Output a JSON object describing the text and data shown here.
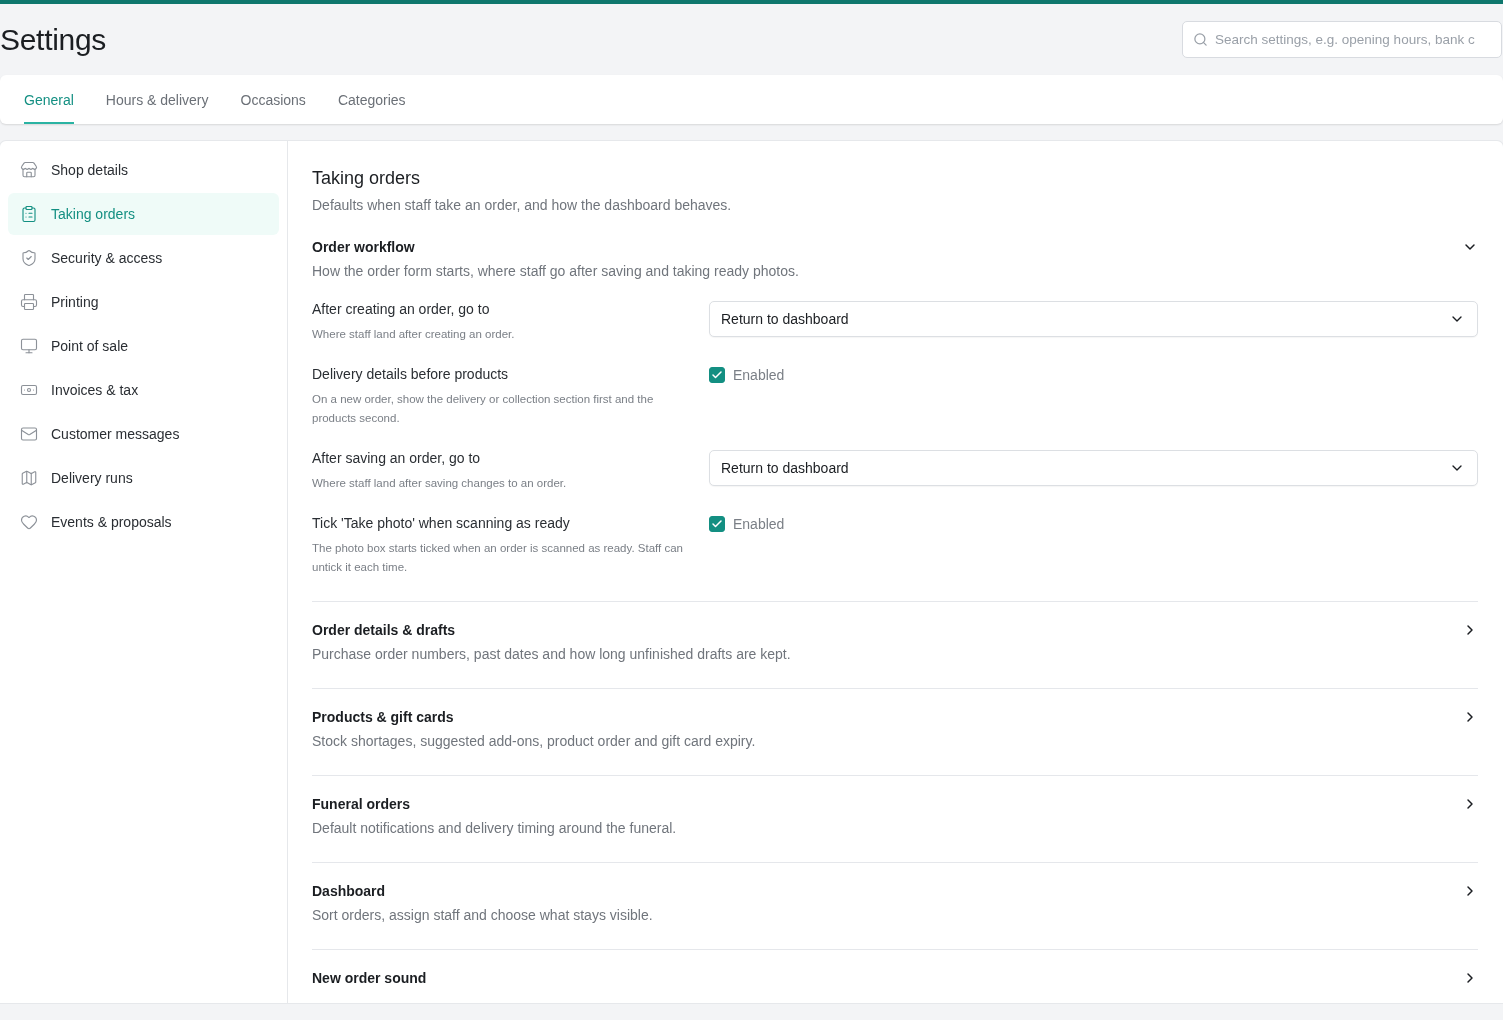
{
  "page": {
    "title": "Settings"
  },
  "search": {
    "placeholder": "Search settings, e.g. opening hours, bank c"
  },
  "tabs": [
    {
      "label": "General",
      "selected": true
    },
    {
      "label": "Hours & delivery",
      "selected": false
    },
    {
      "label": "Occasions",
      "selected": false
    },
    {
      "label": "Categories",
      "selected": false
    }
  ],
  "sidebar": {
    "items": [
      {
        "label": "Shop details",
        "selected": false
      },
      {
        "label": "Taking orders",
        "selected": true
      },
      {
        "label": "Security & access",
        "selected": false
      },
      {
        "label": "Printing",
        "selected": false
      },
      {
        "label": "Point of sale",
        "selected": false
      },
      {
        "label": "Invoices & tax",
        "selected": false
      },
      {
        "label": "Customer messages",
        "selected": false
      },
      {
        "label": "Delivery runs",
        "selected": false
      },
      {
        "label": "Events & proposals",
        "selected": false
      }
    ]
  },
  "content": {
    "title": "Taking orders",
    "subtitle": "Defaults when staff take an order, and how the dashboard behaves.",
    "sections": [
      {
        "title": "Order workflow",
        "description": "How the order form starts, where staff go after saving and taking ready photos.",
        "expanded": true,
        "settings": [
          {
            "kind": "select",
            "label": "After creating an order, go to",
            "help": "Where staff land after creating an order.",
            "value": "Return to dashboard"
          },
          {
            "kind": "checkbox",
            "label": "Delivery details before products",
            "help": "On a new order, show the delivery or collection section first and the products second.",
            "checked": true,
            "value": "Enabled"
          },
          {
            "kind": "select",
            "label": "After saving an order, go to",
            "help": "Where staff land after saving changes to an order.",
            "value": "Return to dashboard"
          },
          {
            "kind": "checkbox",
            "label": "Tick 'Take photo' when scanning as ready",
            "help": "The photo box starts ticked when an order is scanned as ready. Staff can untick it each time.",
            "checked": true,
            "value": "Enabled"
          }
        ]
      },
      {
        "title": "Order details & drafts",
        "description": "Purchase order numbers, past dates and how long unfinished drafts are kept.",
        "expanded": false
      },
      {
        "title": "Products & gift cards",
        "description": "Stock shortages, suggested add-ons, product order and gift card expiry.",
        "expanded": false
      },
      {
        "title": "Funeral orders",
        "description": "Default notifications and delivery timing around the funeral.",
        "expanded": false
      },
      {
        "title": "Dashboard",
        "description": "Sort orders, assign staff and choose what stays visible.",
        "expanded": false
      },
      {
        "title": "New order sound",
        "expanded": false
      }
    ]
  }
}
